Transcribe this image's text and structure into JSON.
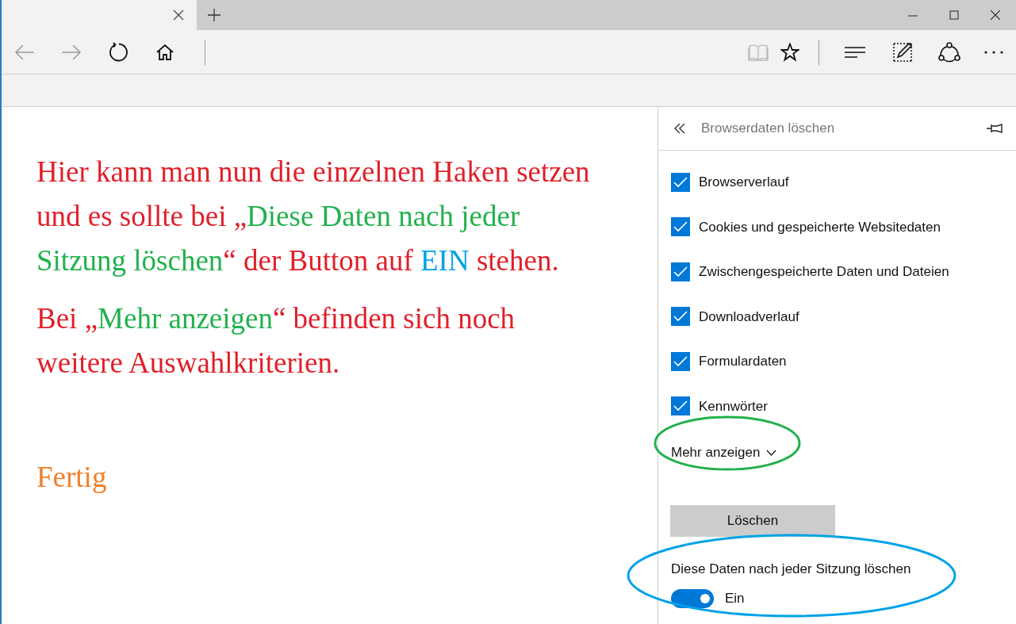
{
  "annotation": {
    "paragraphs": [
      {
        "segments": [
          {
            "text": "Hier kann man nun die einzelnen Haken setzen und es sollte bei „",
            "color": "#e0202a"
          },
          {
            "text": "Diese Daten nach jeder Sitzung löschen",
            "color": "#22b14c"
          },
          {
            "text": "“ der Button auf ",
            "color": "#e0202a"
          },
          {
            "text": "EIN",
            "color": "#00a2e8"
          },
          {
            "text": " stehen.",
            "color": "#e0202a"
          }
        ]
      },
      {
        "segments": [
          {
            "text": "Bei „",
            "color": "#e0202a"
          },
          {
            "text": "Mehr anzeigen",
            "color": "#22b14c"
          },
          {
            "text": "“ befinden sich noch weitere Auswahlkriterien.",
            "color": "#e0202a"
          }
        ]
      }
    ],
    "done": {
      "text": "Fertig",
      "color": "#f07f2a"
    }
  },
  "panel": {
    "title": "Browserdaten löschen",
    "options": [
      {
        "label": "Browserverlauf",
        "checked": true
      },
      {
        "label": "Cookies und gespeicherte Websitedaten",
        "checked": true
      },
      {
        "label": "Zwischengespeicherte Daten und Dateien",
        "checked": true
      },
      {
        "label": "Downloadverlauf",
        "checked": true
      },
      {
        "label": "Formulardaten",
        "checked": true
      },
      {
        "label": "Kennwörter",
        "checked": true
      }
    ],
    "more": "Mehr anzeigen",
    "clear_button": "Löschen",
    "auto_clear": {
      "label": "Diese Daten nach jeder Sitzung löschen",
      "on": true,
      "state_text": "Ein"
    }
  }
}
